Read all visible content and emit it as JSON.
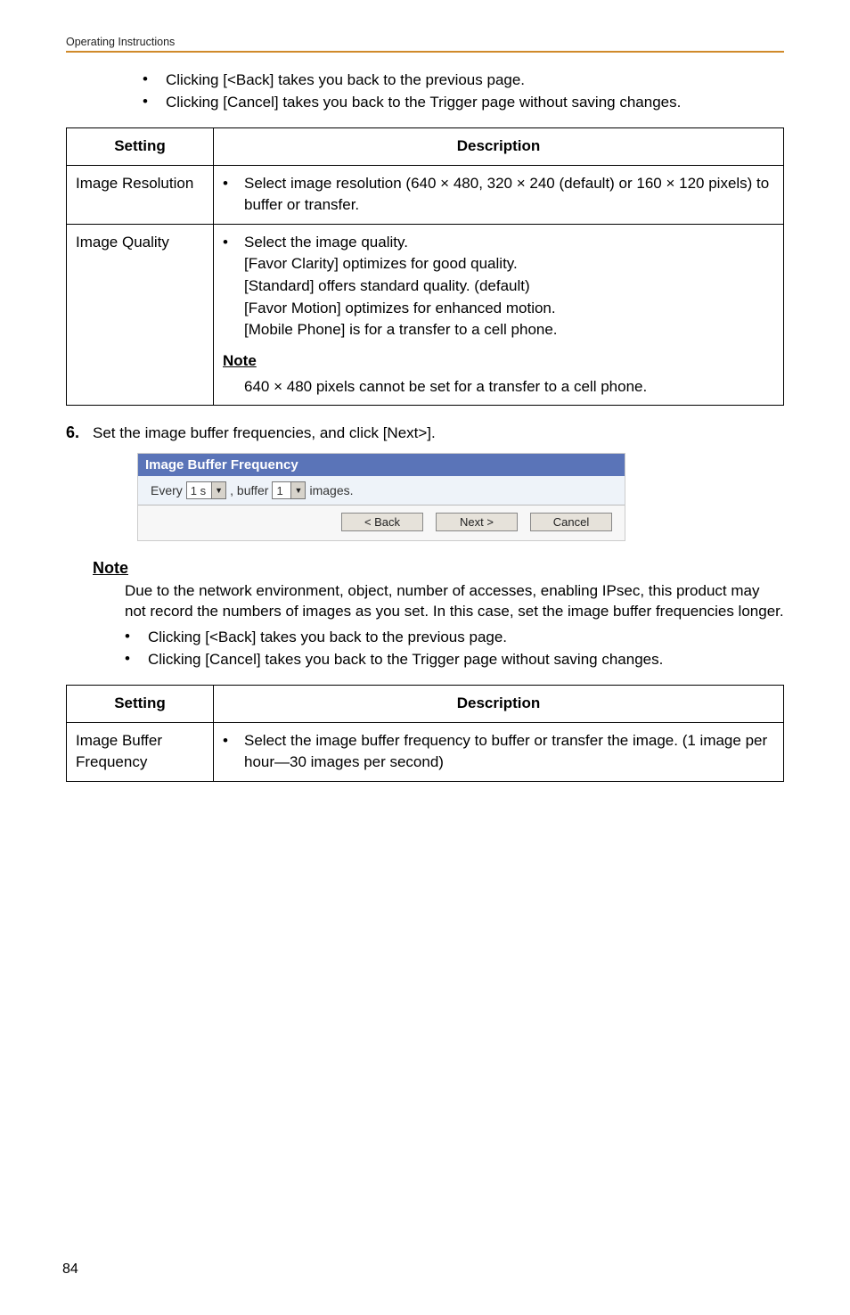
{
  "header": {
    "text": "Operating Instructions"
  },
  "top_bullets": [
    "Clicking [<Back] takes you back to the previous page.",
    "Clicking [Cancel] takes you back to the Trigger page without saving changes."
  ],
  "table1": {
    "headers": {
      "setting": "Setting",
      "description": "Description"
    },
    "rows": [
      {
        "setting": "Image Resolution",
        "bullets": [
          "Select image resolution (640 × 480, 320 × 240 (default) or 160 × 120 pixels) to buffer or transfer."
        ]
      },
      {
        "setting": "Image Quality",
        "bullets": [
          "Select the image quality.\n[Favor Clarity] optimizes for good quality.\n[Standard] offers standard quality. (default)\n[Favor Motion] optimizes for enhanced motion.\n[Mobile Phone] is for a transfer to a cell phone."
        ],
        "note_heading": "Note",
        "note_body": "640 × 480 pixels cannot be set for a transfer to a cell phone."
      }
    ]
  },
  "step6": {
    "num": "6.",
    "text": "Set the image buffer frequencies, and click [Next>]."
  },
  "ibf": {
    "title": "Image Buffer Frequency",
    "prefix": "Every",
    "select1": "1 s",
    "mid": ", buffer",
    "select2": "1",
    "suffix": "images.",
    "btn_back": "< Back",
    "btn_next": "Next >",
    "btn_cancel": "Cancel"
  },
  "note2": {
    "heading": "Note",
    "body": "Due to the network environment, object, number of accesses, enabling IPsec, this product may not record the numbers of images as you set. In this case, set the image buffer frequencies longer.",
    "bullets": [
      "Clicking [<Back] takes you back to the previous page.",
      "Clicking [Cancel] takes you back to the Trigger page without saving changes."
    ]
  },
  "table2": {
    "headers": {
      "setting": "Setting",
      "description": "Description"
    },
    "rows": [
      {
        "setting": "Image Buffer Frequency",
        "bullets": [
          "Select the image buffer frequency to buffer or transfer the image. (1 image per hour—30 images per second)"
        ]
      }
    ]
  },
  "page_number": "84"
}
